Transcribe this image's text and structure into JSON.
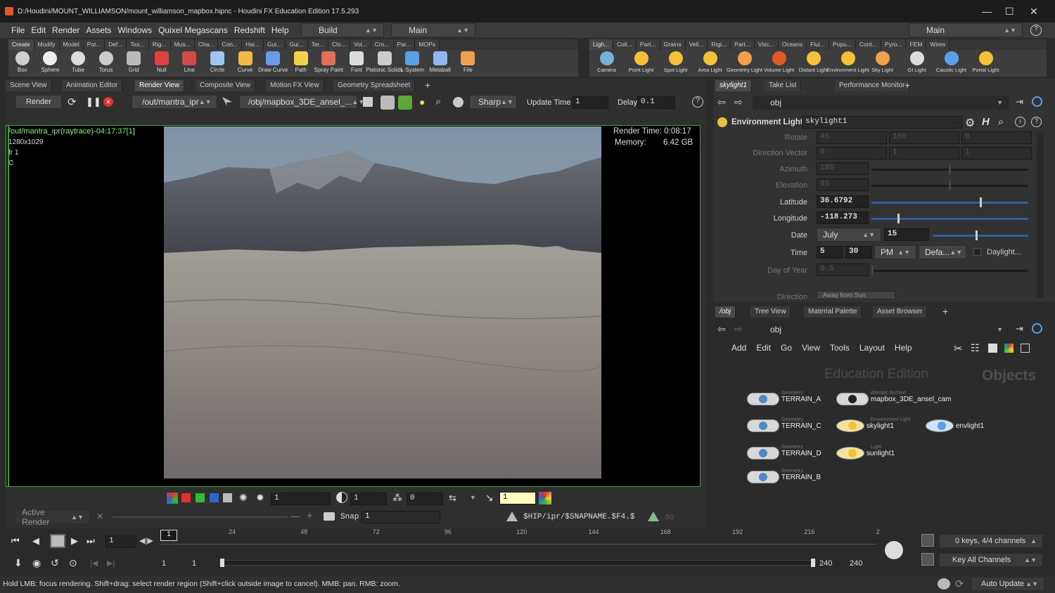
{
  "title_bar": {
    "title": "D:/Houdini/MOUNT_WILLIAMSON/mount_williamson_mapbox.hipnc - Houdini FX Education Edition 17.5.293"
  },
  "menu": {
    "items": [
      "File",
      "Edit",
      "Render",
      "Assets",
      "Windows",
      "Quixel Megascans",
      "Redshift",
      "Help"
    ],
    "desktop": "Build",
    "network": "Main",
    "right_desktop": "Main"
  },
  "shelf_tabs": [
    "Create",
    "Modify",
    "Model",
    "Pol...",
    "Def...",
    "Tex...",
    "Rig...",
    "Mus...",
    "Cha...",
    "Con...",
    "Hai...",
    "Gui...",
    "Gui...",
    "Ter...",
    "Clo...",
    "Vol...",
    "Cro...",
    "Par...",
    "MOPs"
  ],
  "shelf_tools": [
    "Box",
    "Sphere",
    "Tube",
    "Torus",
    "Grid",
    "Null",
    "Line",
    "Circle",
    "Curve",
    "Draw Curve",
    "Path",
    "Spray Paint",
    "Font",
    "Platonic Solids",
    "L-System",
    "Metaball",
    "File"
  ],
  "shelf_tabs2": [
    "Ligh...",
    "Coll...",
    "Part...",
    "Grains",
    "Vell...",
    "Rigi...",
    "Part...",
    "Visc...",
    "Oceans",
    "Flui...",
    "Popu...",
    "Cont...",
    "Pyro...",
    "FEM",
    "Wires"
  ],
  "light_tools": [
    "Camera",
    "Point Light",
    "Spot Light",
    "Area Light",
    "Geometry Light",
    "Volume Light",
    "Distant Light",
    "Environment Light",
    "Sky Light",
    "GI Light",
    "Caustic Light",
    "Portal Light"
  ],
  "pane_tabs": [
    "Scene View",
    "Animation Editor",
    "Render View",
    "Composite View",
    "Motion FX View",
    "Geometry Spreadsheet"
  ],
  "render_toolbar": {
    "render": "Render",
    "rop": "/out/mantra_ipr",
    "camera": "/obj/mapbox_3DE_ansel_...",
    "filter": "Sharp",
    "update_label": "Update Time",
    "update_value": "1",
    "delay_label": "Delay",
    "delay_value": "0.1"
  },
  "viewer": {
    "info_line1": "/out/mantra_ipr(raytrace)-04:17:37[1]",
    "info_line2": "1280x1029",
    "info_line3": "fr 1",
    "info_line4": "C",
    "render_time": "Render Time: 0:08:17",
    "memory_label": "Memory:",
    "memory_value": "6.42 GB"
  },
  "viewer_bottom": {
    "field1": "1",
    "field2": "1",
    "field3": "0",
    "field4": "1"
  },
  "snap_bar": {
    "active": "Active Render",
    "snap_label": "Snap",
    "snap_value": "1",
    "path": "$HIP/ipr/$SNAPNAME.$F4.$",
    "num": "60"
  },
  "param_tabs": [
    "skylight1",
    "Take List",
    "Performance Monitor"
  ],
  "param_path": "obj",
  "node_header": {
    "type": "Environment Light",
    "name": "skylight1"
  },
  "params": {
    "rotate": {
      "label": "Rotate",
      "v": [
        "45",
        "180",
        "0"
      ]
    },
    "direction": {
      "label": "Direction Vector",
      "v": [
        "0",
        "1",
        "1"
      ]
    },
    "azimuth": {
      "label": "Azimuth",
      "v": "180"
    },
    "elevation": {
      "label": "Elevation",
      "v": "45"
    },
    "latitude": {
      "label": "Latitude",
      "v": "36.6792"
    },
    "longitude": {
      "label": "Longitude",
      "v": "-118.273"
    },
    "date": {
      "label": "Date",
      "month": "July",
      "day": "15"
    },
    "time": {
      "label": "Time",
      "h": "5",
      "m": "30",
      "ampm": "PM",
      "tz": "Defa...",
      "dst": "Daylight..."
    },
    "dayofyear": {
      "label": "Day of Year",
      "v": "0.5"
    },
    "more": {
      "label": "Direction",
      "v": "Away from Sun"
    }
  },
  "network_tabs": [
    "/obj",
    "Tree View",
    "Material Palette",
    "Asset Browser"
  ],
  "network_menu": [
    "Add",
    "Edit",
    "Go",
    "View",
    "Tools",
    "Layout",
    "Help"
  ],
  "network": {
    "watermark": "Education Edition",
    "context": "Objects",
    "nodes": [
      {
        "type": "Geometry",
        "name": "TERRAIN_A"
      },
      {
        "type": "Geometry",
        "name": "TERRAIN_C"
      },
      {
        "type": "Geometry",
        "name": "TERRAIN_D"
      },
      {
        "type": "Geometry",
        "name": "TERRAIN_B"
      },
      {
        "type": "Alembic Archive",
        "name": "mapbox_3DE_ansel_cam"
      },
      {
        "type": "Environment Light",
        "name": "skylight1"
      },
      {
        "type": "Light",
        "name": "sunlight1"
      },
      {
        "type": "",
        "name": "envlight1"
      }
    ]
  },
  "timeline": {
    "frame": "1",
    "ticks": [
      "24",
      "48",
      "72",
      "96",
      "120",
      "144",
      "168",
      "192",
      "216",
      "2"
    ],
    "start": "1",
    "start2": "1",
    "end": "240",
    "end2": "240",
    "keys": "0 keys, 4/4 channels",
    "key_all": "Key All Channels",
    "current": "1"
  },
  "status": {
    "text": "Hold LMB: focus rendering. Shift+drag: select render region (Shift+click outside image to cancel). MMB: pan. RMB: zoom.",
    "auto_update": "Auto Update"
  }
}
